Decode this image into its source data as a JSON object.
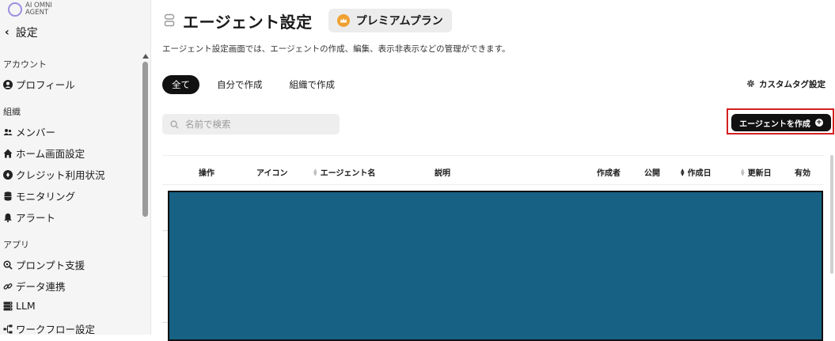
{
  "app": {
    "logo_text": "AI OMNI AGENT"
  },
  "sidebar": {
    "back_label": "設定",
    "sections": [
      {
        "label": "アカウント",
        "items": [
          {
            "label": "プロフィール",
            "icon": "user-circle-icon"
          }
        ]
      },
      {
        "label": "組織",
        "items": [
          {
            "label": "メンバー",
            "icon": "users-icon"
          },
          {
            "label": "ホーム画面設定",
            "icon": "home-icon"
          },
          {
            "label": "クレジット利用状況",
            "icon": "coin-icon"
          },
          {
            "label": "モニタリング",
            "icon": "database-icon"
          },
          {
            "label": "アラート",
            "icon": "bell-icon"
          }
        ]
      },
      {
        "label": "アプリ",
        "items": [
          {
            "label": "プロンプト支援",
            "icon": "search-bulb-icon"
          },
          {
            "label": "データ連携",
            "icon": "link-icon"
          },
          {
            "label": "LLM",
            "icon": "server-icon"
          },
          {
            "label": "ワークフロー設定",
            "icon": "workflow-icon"
          }
        ]
      }
    ]
  },
  "header": {
    "title": "エージェント設定",
    "plan_badge": "プレミアムプラン",
    "description": "エージェント設定画面では、エージェントの作成、編集、表示非表示などの管理ができます。"
  },
  "tabs": [
    {
      "label": "全て",
      "active": true
    },
    {
      "label": "自分で作成",
      "active": false
    },
    {
      "label": "組織で作成",
      "active": false
    }
  ],
  "custom_tag_label": "カスタムタグ設定",
  "search": {
    "placeholder": "名前で検索",
    "value": ""
  },
  "create_button_label": "エージェントを作成",
  "table": {
    "columns": [
      "操作",
      "アイコン",
      "エージェント名",
      "説明",
      "作成者",
      "公開",
      "作成日",
      "更新日",
      "有効"
    ]
  },
  "colors": {
    "accent_dark": "#111111",
    "table_fill": "#176184",
    "highlight_border": "#d42020",
    "crown": "#f0a030"
  }
}
